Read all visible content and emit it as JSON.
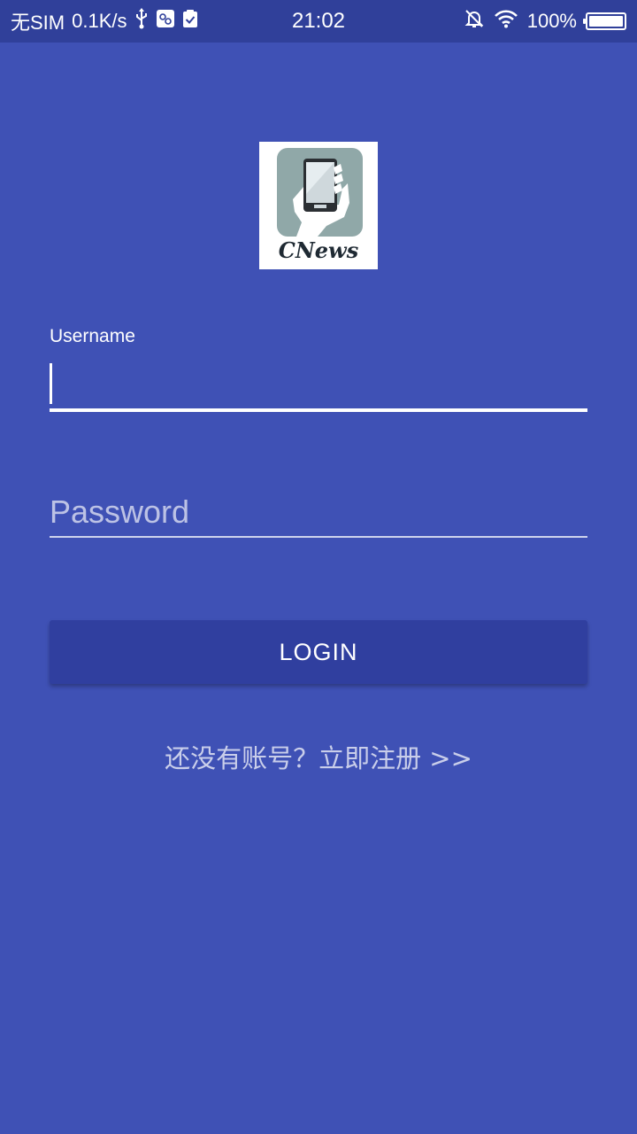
{
  "status_bar": {
    "carrier": "无SIM",
    "net_speed": "0.1K/s",
    "time": "21:02",
    "battery": "100%",
    "battery_level": 1.0,
    "icons": [
      "usb-icon",
      "debug-icon",
      "clipboard-check-icon",
      "bell-off-icon",
      "wifi-icon",
      "battery-icon"
    ]
  },
  "logo": {
    "wordmark": "CNews"
  },
  "form": {
    "username_label": "Username",
    "username_value": "",
    "password_placeholder": "Password",
    "password_value": ""
  },
  "login_button": {
    "label": "LOGIN"
  },
  "register_link": {
    "text": "还没有账号？立即注册 >>"
  },
  "colors": {
    "background": "#3f51b5",
    "status_bar": "#30409a",
    "button": "#303f9f",
    "text": "#ffffff"
  }
}
